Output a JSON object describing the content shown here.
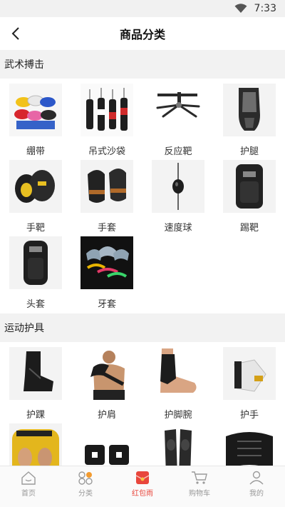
{
  "status": {
    "time": "7:33"
  },
  "header": {
    "title": "商品分类"
  },
  "sections": [
    {
      "title": "武术搏击",
      "items": [
        {
          "label": "绷带",
          "icon": "hand-wraps"
        },
        {
          "label": "吊式沙袋",
          "icon": "punching-bags"
        },
        {
          "label": "反应靶",
          "icon": "reflex-target"
        },
        {
          "label": "护腿",
          "icon": "shin-guard"
        },
        {
          "label": "手靶",
          "icon": "focus-mitts"
        },
        {
          "label": "手套",
          "icon": "mma-gloves"
        },
        {
          "label": "速度球",
          "icon": "speed-ball"
        },
        {
          "label": "踢靶",
          "icon": "kick-pad"
        },
        {
          "label": "头套",
          "icon": "headgear"
        },
        {
          "label": "牙套",
          "icon": "mouth-guards"
        }
      ]
    },
    {
      "title": "运动护具",
      "items": [
        {
          "label": "护踝",
          "icon": "ankle-brace"
        },
        {
          "label": "护肩",
          "icon": "shoulder-brace"
        },
        {
          "label": "护脚腕",
          "icon": "ankle-support"
        },
        {
          "label": "护手",
          "icon": "hand-guard"
        },
        {
          "label": "",
          "icon": "boxing-helmets"
        },
        {
          "label": "",
          "icon": "wristbands"
        },
        {
          "label": "",
          "icon": "knee-sleeves"
        },
        {
          "label": "",
          "icon": "waist-belt"
        }
      ]
    }
  ],
  "tabbar": [
    {
      "label": "首页",
      "icon": "home-icon"
    },
    {
      "label": "分类",
      "icon": "category-icon"
    },
    {
      "label": "红包雨",
      "icon": "red-envelope-icon"
    },
    {
      "label": "购物车",
      "icon": "cart-icon"
    },
    {
      "label": "我的",
      "icon": "profile-icon"
    }
  ],
  "colors": {
    "accent": "#e8463c",
    "section_bg": "#f2f2f2",
    "tab_text": "#999999"
  }
}
